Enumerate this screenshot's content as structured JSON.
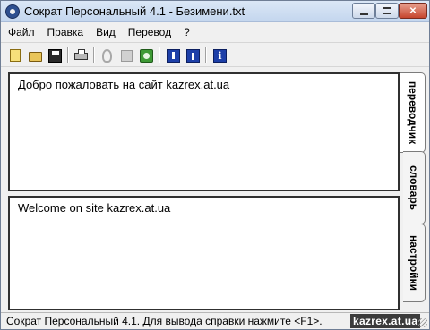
{
  "window": {
    "title": "Сократ Персональный 4.1 - Безимени.txt",
    "close_label": "✕"
  },
  "menu": [
    {
      "label": "Файл"
    },
    {
      "label": "Правка"
    },
    {
      "label": "Вид"
    },
    {
      "label": "Перевод"
    },
    {
      "label": "?"
    }
  ],
  "toolbar": {
    "icons": [
      "new-file-icon",
      "open-folder-icon",
      "save-icon",
      "print-icon",
      "cut-icon",
      "copy-icon",
      "paste-icon",
      "import-icon",
      "export-icon",
      "info-icon"
    ],
    "info_glyph": "i"
  },
  "panes": {
    "source_text": "Добро пожаловать на сайт kazrex.at.ua",
    "translation_text": "Welcome on site kazrex.at.ua"
  },
  "tabs": [
    {
      "label": "переводчик",
      "active": true
    },
    {
      "label": "словарь",
      "active": false
    },
    {
      "label": "настройки",
      "active": false
    }
  ],
  "status": {
    "text": "Сократ Персональный  4.1.  Для вывода справки нажмите <F1>.",
    "watermark": "kazrex.at.ua"
  },
  "colors": {
    "titlebar": "#c4d6ee",
    "close_button": "#c6452e",
    "window_bg": "#f0f0f0"
  }
}
